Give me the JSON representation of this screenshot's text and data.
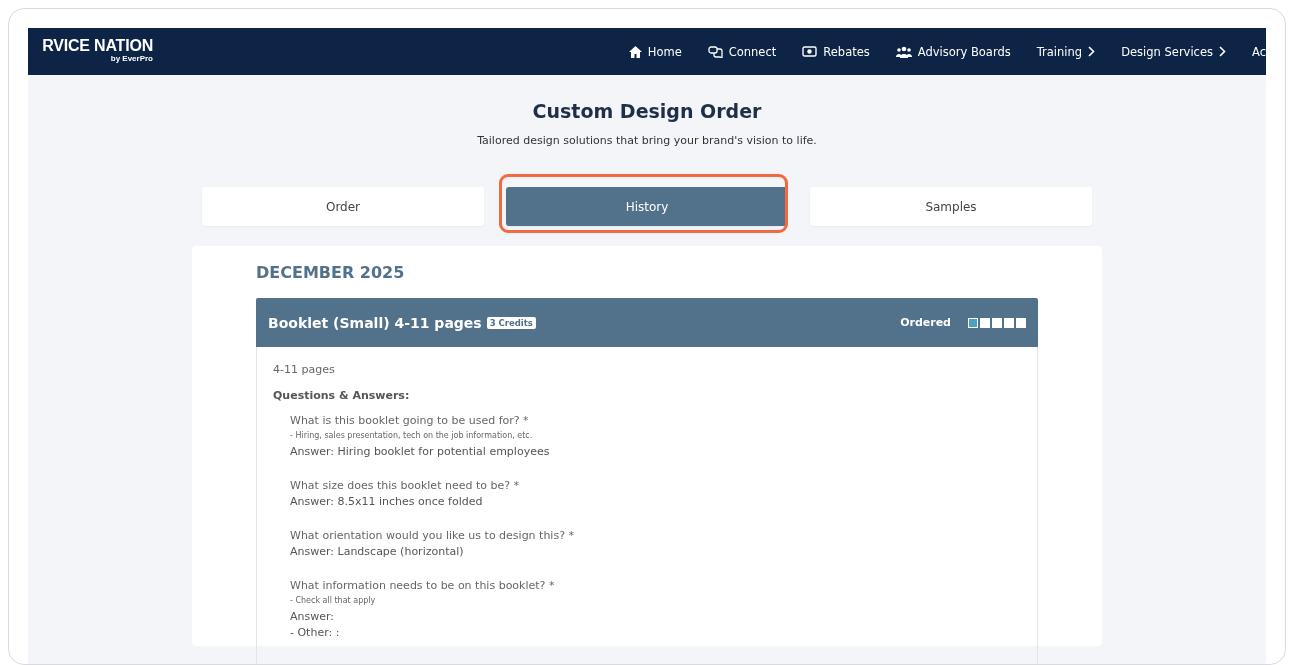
{
  "brand": {
    "name": "RVICE NATION",
    "tagline": "by EverPro"
  },
  "nav": [
    {
      "label": "Home",
      "submenu": false
    },
    {
      "label": "Connect",
      "submenu": false
    },
    {
      "label": "Rebates",
      "submenu": false
    },
    {
      "label": "Advisory Boards",
      "submenu": false
    },
    {
      "label": "Training",
      "submenu": true
    },
    {
      "label": "Design Services",
      "submenu": true
    },
    {
      "label": "Ac",
      "submenu": false
    }
  ],
  "page": {
    "title": "Custom Design Order",
    "subtitle": "Tailored design solutions that bring your brand's vision to life."
  },
  "tabs": [
    {
      "label": "Order",
      "selected": false
    },
    {
      "label": "History",
      "selected": true
    },
    {
      "label": "Samples",
      "selected": false
    }
  ],
  "month": "DECEMBER 2025",
  "order": {
    "title": "Booklet (Small) 4-11 pages",
    "badge": "3 Credits",
    "status": "Ordered",
    "status_steps": [
      {
        "on": true
      },
      {
        "on": false
      },
      {
        "on": false
      },
      {
        "on": false
      },
      {
        "on": false
      }
    ],
    "summary": "4-11 pages",
    "qa_heading": "Questions & Answers:",
    "questions": [
      {
        "question": "What is this booklet going to be used for? *",
        "hint": "- Hiring, sales presentation, tech on the job information, etc.",
        "answer": "Answer: Hiring booklet for potential employees"
      },
      {
        "question": "What size does this booklet need to be? *",
        "answer": "Answer: 8.5x11 inches once folded"
      },
      {
        "question": "What orientation would you like us to design this? *",
        "answer": "Answer: Landscape (horizontal)"
      },
      {
        "question": "What information needs to be on this booklet? *",
        "hint": "- Check all that apply",
        "answer": "Answer:",
        "extra": "- Other: :"
      }
    ]
  }
}
